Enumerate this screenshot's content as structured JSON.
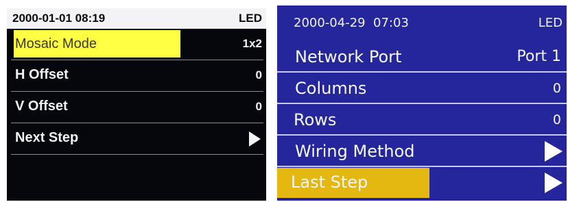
{
  "left_menu": {
    "datetime": "2000-01-01 08:19",
    "mode": "LED",
    "items": [
      {
        "label": "Mosaic Mode",
        "value": "1x2",
        "selected": true
      },
      {
        "label": "H Offset",
        "value": "0"
      },
      {
        "label": "V Offset",
        "value": "0"
      },
      {
        "label": "Next Step",
        "icon": "play-triangle-icon"
      }
    ],
    "colors": {
      "background": "#05070c",
      "highlight": "#ffff43",
      "header": "#f3f3f6"
    }
  },
  "right_menu": {
    "datetime": "2000-04-29  07:03",
    "mode": "LED",
    "items": [
      {
        "label": "Network Port",
        "value": "Port 1"
      },
      {
        "label": "Columns",
        "value": "0"
      },
      {
        "label": "Rows",
        "value": "0"
      },
      {
        "label": "Wiring Method",
        "icon": "play-triangle-icon"
      },
      {
        "label": "Last Step",
        "icon": "play-triangle-icon",
        "selected": true
      }
    ],
    "colors": {
      "background": "#25269c",
      "highlight": "#e5b711"
    }
  }
}
